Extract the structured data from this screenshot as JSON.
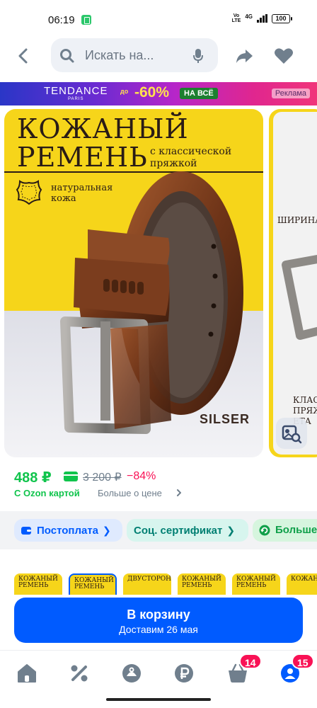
{
  "status_bar": {
    "time": "06:19",
    "volte_top": "Vo",
    "volte_bottom": "LTE",
    "network": "4G",
    "battery": "100"
  },
  "header": {
    "search_placeholder": "Искать на..."
  },
  "ad_banner": {
    "brand": "TENDANCE",
    "brand_sub": "PARIS",
    "prefix": "до",
    "discount": "-60%",
    "tag": "НА ВСЁ",
    "label": "Реклама"
  },
  "gallery": {
    "slide1": {
      "title_line1": "КОЖАНЫЙ",
      "title_line2": "РЕМЕНЬ",
      "subtitle_line1": "с классической",
      "subtitle_line2": "пряжкой",
      "material_line1": "натуральная",
      "material_line2": "кожа",
      "brand": "SILSER"
    },
    "slide2": {
      "text_top": "ШИРИНА",
      "text_bottom_line1": "КЛАС",
      "text_bottom_line2": "ПРЯЖ",
      "text_bottom_line3": "ЕТА"
    }
  },
  "price": {
    "current": "488 ₽",
    "old": "3 200 ₽",
    "discount": "−84%",
    "ozon_card": "С Ozon картой",
    "more": "Больше о цене"
  },
  "chips": [
    {
      "label": "Постоплата"
    },
    {
      "label": "Соц. сертификат"
    },
    {
      "label": "Больше"
    }
  ],
  "thumbnails": [
    {
      "line1": "КОЖАНЫЙ",
      "line2": "РЕМЕНЬ"
    },
    {
      "line1": "КОЖАНЫЙ",
      "line2": "РЕМЕНЬ"
    },
    {
      "line1": "ДВУСТОРОННИ",
      "line2": ""
    },
    {
      "line1": "КОЖАНЫЙ",
      "line2": "РЕМЕНЬ"
    },
    {
      "line1": "КОЖАНЫЙ",
      "line2": "РЕМЕНЬ"
    },
    {
      "line1": "КОЖАНЫЙ",
      "line2": ""
    }
  ],
  "cart_button": {
    "title": "В корзину",
    "subtitle": "Доставим 26 мая"
  },
  "bottom_nav": {
    "cart_badge": "14",
    "profile_badge": "15"
  },
  "colors": {
    "accent": "#005bff",
    "price_green": "#10c44c",
    "discount_red": "#f91155",
    "banner_yellow": "#f6d51a"
  }
}
